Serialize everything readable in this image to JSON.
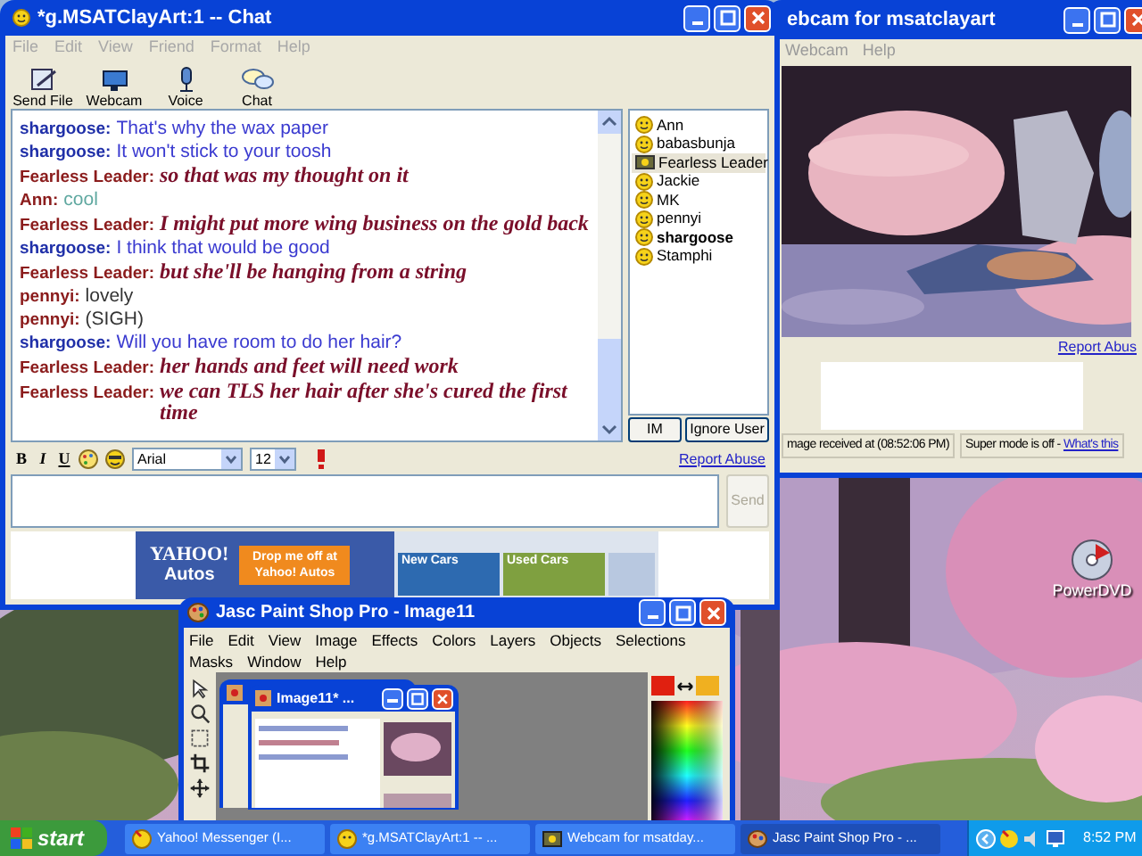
{
  "desktop": {
    "icons": [
      {
        "label": "PowerDVD"
      }
    ]
  },
  "chat_window": {
    "title": "*g.MSATClayArt:1 -- Chat",
    "menu": [
      "File",
      "Edit",
      "View",
      "Friend",
      "Format",
      "Help"
    ],
    "toolbar": [
      {
        "label": "Send File",
        "kind": "file"
      },
      {
        "label": "Webcam",
        "kind": "webcam"
      },
      {
        "label": "Voice",
        "kind": "voice"
      },
      {
        "label": "Chat",
        "kind": "chat"
      }
    ],
    "messages": [
      {
        "sender": {
          "name": "shargoose:",
          "color": "#1f2fa8"
        },
        "text": "That's why the wax paper",
        "kind": "plain",
        "color": "#3a3ad0"
      },
      {
        "sender": {
          "name": "shargoose:",
          "color": "#1f2fa8"
        },
        "text": "It won't stick to your toosh",
        "kind": "plain",
        "color": "#3a3ad0"
      },
      {
        "sender": {
          "name": "Fearless Leader:",
          "color": "#8b1c1c"
        },
        "text": "so that was my thought on it",
        "kind": "script",
        "color": "#7a0f2a"
      },
      {
        "sender": {
          "name": "Ann:",
          "color": "#8b1c1c"
        },
        "text": "cool",
        "kind": "plain",
        "color": "#5fa8a0"
      },
      {
        "sender": {
          "name": "Fearless Leader:",
          "color": "#8b1c1c"
        },
        "text": "I might put more wing business on the gold back",
        "kind": "script",
        "color": "#7a0f2a"
      },
      {
        "sender": {
          "name": "shargoose:",
          "color": "#1f2fa8"
        },
        "text": "I think that would be good",
        "kind": "plain",
        "color": "#3a3ad0"
      },
      {
        "sender": {
          "name": "Fearless Leader:",
          "color": "#8b1c1c"
        },
        "text": "but she'll be hanging from a string",
        "kind": "script",
        "color": "#7a0f2a"
      },
      {
        "sender": {
          "name": "pennyi:",
          "color": "#8b1c1c"
        },
        "text": "lovely",
        "kind": "plain",
        "color": "#333333"
      },
      {
        "sender": {
          "name": "pennyi:",
          "color": "#8b1c1c"
        },
        "text": "(SIGH)",
        "kind": "plain",
        "color": "#333333"
      },
      {
        "sender": {
          "name": "shargoose:",
          "color": "#1f2fa8"
        },
        "text": "Will you have room to do her hair?",
        "kind": "plain",
        "color": "#3a3ad0"
      },
      {
        "sender": {
          "name": "Fearless Leader:",
          "color": "#8b1c1c"
        },
        "text": "her hands and feet will need work",
        "kind": "script",
        "color": "#7a0f2a"
      },
      {
        "sender": {
          "name": "Fearless Leader:",
          "color": "#8b1c1c"
        },
        "text": "we can TLS her hair after she's cured the first time",
        "kind": "script",
        "color": "#7a0f2a"
      }
    ],
    "users": [
      {
        "name": "Ann",
        "kind": "smiley",
        "selected": false,
        "bold": false
      },
      {
        "name": "babasbunja",
        "kind": "smiley",
        "selected": false,
        "bold": false
      },
      {
        "name": "Fearless Leader",
        "kind": "webcam",
        "selected": true,
        "bold": false
      },
      {
        "name": "Jackie",
        "kind": "smiley",
        "selected": false,
        "bold": false
      },
      {
        "name": "MK",
        "kind": "smiley",
        "selected": false,
        "bold": false
      },
      {
        "name": "pennyi",
        "kind": "smiley",
        "selected": false,
        "bold": false
      },
      {
        "name": "shargoose",
        "kind": "smiley",
        "selected": false,
        "bold": true
      },
      {
        "name": "Stamphi",
        "kind": "smiley",
        "selected": false,
        "bold": false
      }
    ],
    "user_buttons": [
      "IM",
      "Ignore User"
    ],
    "format_buttons": [
      "B",
      "I",
      "U"
    ],
    "font": "Arial",
    "size": "12",
    "report_link": "Report Abuse",
    "send_button": {
      "label": "Send",
      "disabled": true
    },
    "ad": {
      "brand": "YAHOO!",
      "product": "Autos",
      "cta": "Drop me off at Yahoo! Autos",
      "panels": [
        "New Cars",
        "Used Cars"
      ]
    }
  },
  "webcam_window": {
    "title": "ebcam for msatclayart",
    "menu": [
      "Webcam",
      "Help"
    ],
    "report_link": "Report Abus",
    "status": "mage received at (08:52:06 PM)",
    "mode": "Super mode is off - ",
    "mode_link": "What's this"
  },
  "psp_window": {
    "title": "Jasc Paint Shop Pro - Image11",
    "menu": [
      "File",
      "Edit",
      "View",
      "Image",
      "Effects",
      "Colors",
      "Layers",
      "Objects",
      "Selections",
      "Masks",
      "Window",
      "Help"
    ],
    "image_window": {
      "title": "Image11* ..."
    }
  },
  "taskbar": {
    "start": "start",
    "tasks": [
      {
        "label": "Yahoo! Messenger (I...",
        "kind": "messenger",
        "selected": false
      },
      {
        "label": "*g.MSATClayArt:1 -- ...",
        "kind": "chat",
        "selected": false
      },
      {
        "label": "Webcam for msatday...",
        "kind": "webcam",
        "selected": false
      },
      {
        "label": "Jasc Paint Shop Pro - ...",
        "kind": "paint",
        "selected": true
      }
    ],
    "clock": "8:52 PM"
  }
}
